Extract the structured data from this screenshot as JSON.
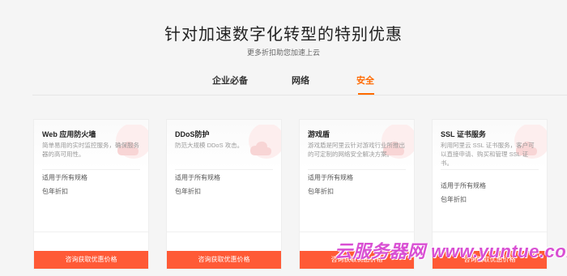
{
  "header": {
    "title": "针对加速数字化转型的特别优惠",
    "subtitle": "更多折扣助您加速上云"
  },
  "tabs": [
    {
      "label": "企业必备",
      "active": false
    },
    {
      "label": "网络",
      "active": false
    },
    {
      "label": "安全",
      "active": true
    }
  ],
  "accent_color": "#ff6a00",
  "button_color": "#ff5a36",
  "cards": [
    {
      "title": "Web 应用防火墙",
      "desc": "简单易用的实时监控服务，确保服务器的高可用性。",
      "feature1": "适用于所有规格",
      "feature2": "包年折扣",
      "button": "咨询获取优惠价格"
    },
    {
      "title": "DDoS防护",
      "desc": "防范大规模 DDoS 攻击。",
      "feature1": "适用于所有规格",
      "feature2": "包年折扣",
      "button": "咨询获取优惠价格"
    },
    {
      "title": "游戏盾",
      "desc": "游戏盾是阿里云针对游戏行业所推出的可定制的网络安全解决方案。",
      "feature1": "适用于所有规格",
      "feature2": "包年折扣",
      "button": "咨询获取优惠价格"
    },
    {
      "title": "SSL 证书服务",
      "desc": "利用阿里云 SSL 证书服务，客户可以直接申请、购买和管理 SSL 证书。",
      "feature1": "适用于所有规格",
      "feature2": "包年折扣",
      "button": "咨询获取优惠价格"
    }
  ],
  "watermark": "云服务器网 www.yuntue.com"
}
